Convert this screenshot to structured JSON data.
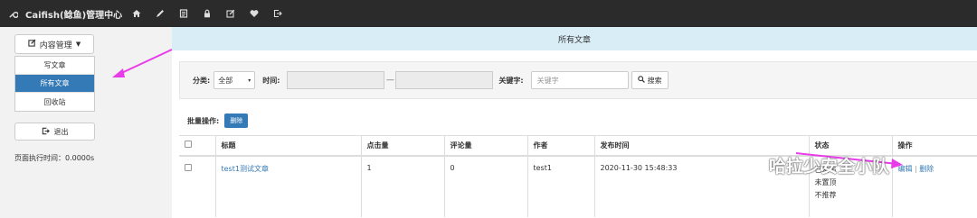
{
  "app": {
    "title": "Caifish(鲶鱼)管理中心",
    "nav_icons": [
      "home-icon",
      "pencil-icon",
      "list-icon",
      "lock-icon",
      "edit-icon",
      "heart-icon",
      "logout-icon"
    ]
  },
  "sidebar": {
    "dropdown_label": "内容管理",
    "items": [
      {
        "label": "写文章",
        "active": false
      },
      {
        "label": "所有文章",
        "active": true
      },
      {
        "label": "回收站",
        "active": false
      }
    ],
    "logout_label": "退出",
    "exec_time": "页面执行时间：0.0000s"
  },
  "main": {
    "header": "所有文章",
    "filter": {
      "category_label": "分类:",
      "category_value": "全部",
      "time_label": "时间:",
      "dash": "—",
      "keyword_label": "关键字:",
      "keyword_placeholder": "关键字",
      "search_label": "搜索"
    },
    "bulk": {
      "label": "批量操作:",
      "delete_label": "删除"
    },
    "table": {
      "headers": [
        "标题",
        "点击量",
        "评论量",
        "作者",
        "发布时间",
        "状态",
        "操作"
      ],
      "rows": [
        {
          "title": "test1测试文章",
          "clicks": "1",
          "comments": "0",
          "author": "test1",
          "time": "2020-11-30 15:48:33",
          "status": [
            "已发布",
            "未置顶",
            "不推荐"
          ],
          "actions": [
            "编辑",
            "|",
            "删除"
          ]
        }
      ]
    }
  },
  "overlay": {
    "watermark": "哈拉少安全小队",
    "arrow_color": "#e83ce8"
  }
}
